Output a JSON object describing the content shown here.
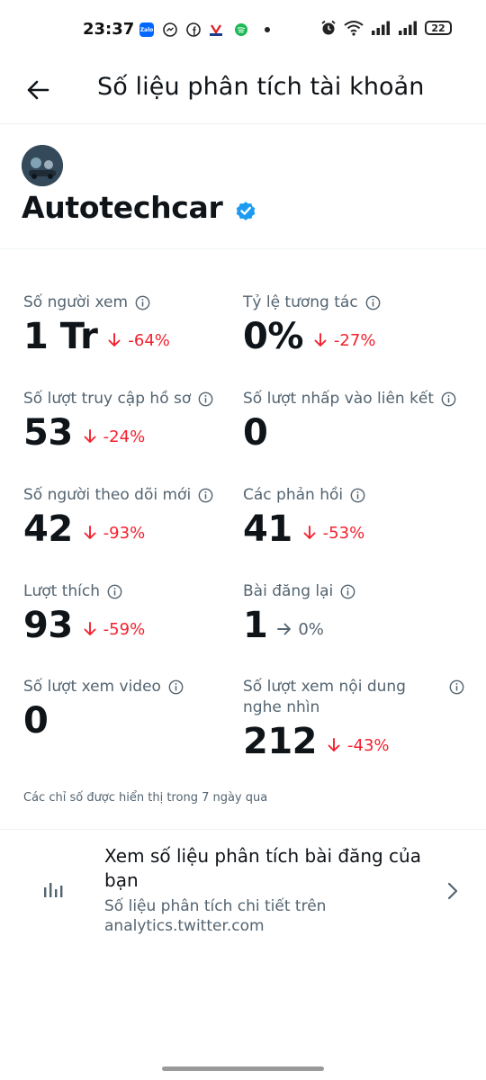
{
  "status_bar": {
    "time": "23:37",
    "battery": "22",
    "app_icons": [
      "zalo-icon",
      "messenger-icon",
      "facebook-icon",
      "vieon-icon",
      "spotify-icon",
      "dot-icon"
    ],
    "zalo_label": "Zalo",
    "right_icons": [
      "alarm-icon",
      "wifi-icon",
      "signal-icon",
      "signal-icon",
      "battery-icon"
    ]
  },
  "header": {
    "title": "Số liệu phân tích tài khoản",
    "back_icon": "back-arrow-icon"
  },
  "profile": {
    "name": "Autotechcar",
    "verified_icon": "verified-badge-icon",
    "verified_color": "#1d9bf0"
  },
  "metrics": [
    {
      "label": "Số người xem",
      "value": "1 Tr",
      "change": "-64%",
      "direction": "down"
    },
    {
      "label": "Tỷ lệ tương tác",
      "value": "0%",
      "change": "-27%",
      "direction": "down"
    },
    {
      "label": "Số lượt truy cập hồ sơ",
      "value": "53",
      "change": "-24%",
      "direction": "down"
    },
    {
      "label": "Số lượt nhấp vào liên kết",
      "value": "0",
      "change": "",
      "direction": "none"
    },
    {
      "label": "Số người theo dõi mới",
      "value": "42",
      "change": "-93%",
      "direction": "down"
    },
    {
      "label": "Các phản hồi",
      "value": "41",
      "change": "-53%",
      "direction": "down"
    },
    {
      "label": "Lượt thích",
      "value": "93",
      "change": "-59%",
      "direction": "down"
    },
    {
      "label": "Bài đăng lại",
      "value": "1",
      "change": "0%",
      "direction": "flat"
    },
    {
      "label": "Số lượt xem video",
      "value": "0",
      "change": "",
      "direction": "none"
    },
    {
      "label": "Số lượt xem nội dung nghe nhìn",
      "value": "212",
      "change": "-43%",
      "direction": "down"
    }
  ],
  "footnote": "Các chỉ số được hiển thị trong 7 ngày qua",
  "analytics_link": {
    "title": "Xem số liệu phân tích bài đăng của bạn",
    "subtitle": "Số liệu phân tích chi tiết trên analytics.twitter.com",
    "icon": "bar-chart-icon",
    "chevron": "chevron-right-icon"
  },
  "colors": {
    "negative": "#f4212e",
    "neutral": "#536471",
    "text": "#0f1419"
  }
}
